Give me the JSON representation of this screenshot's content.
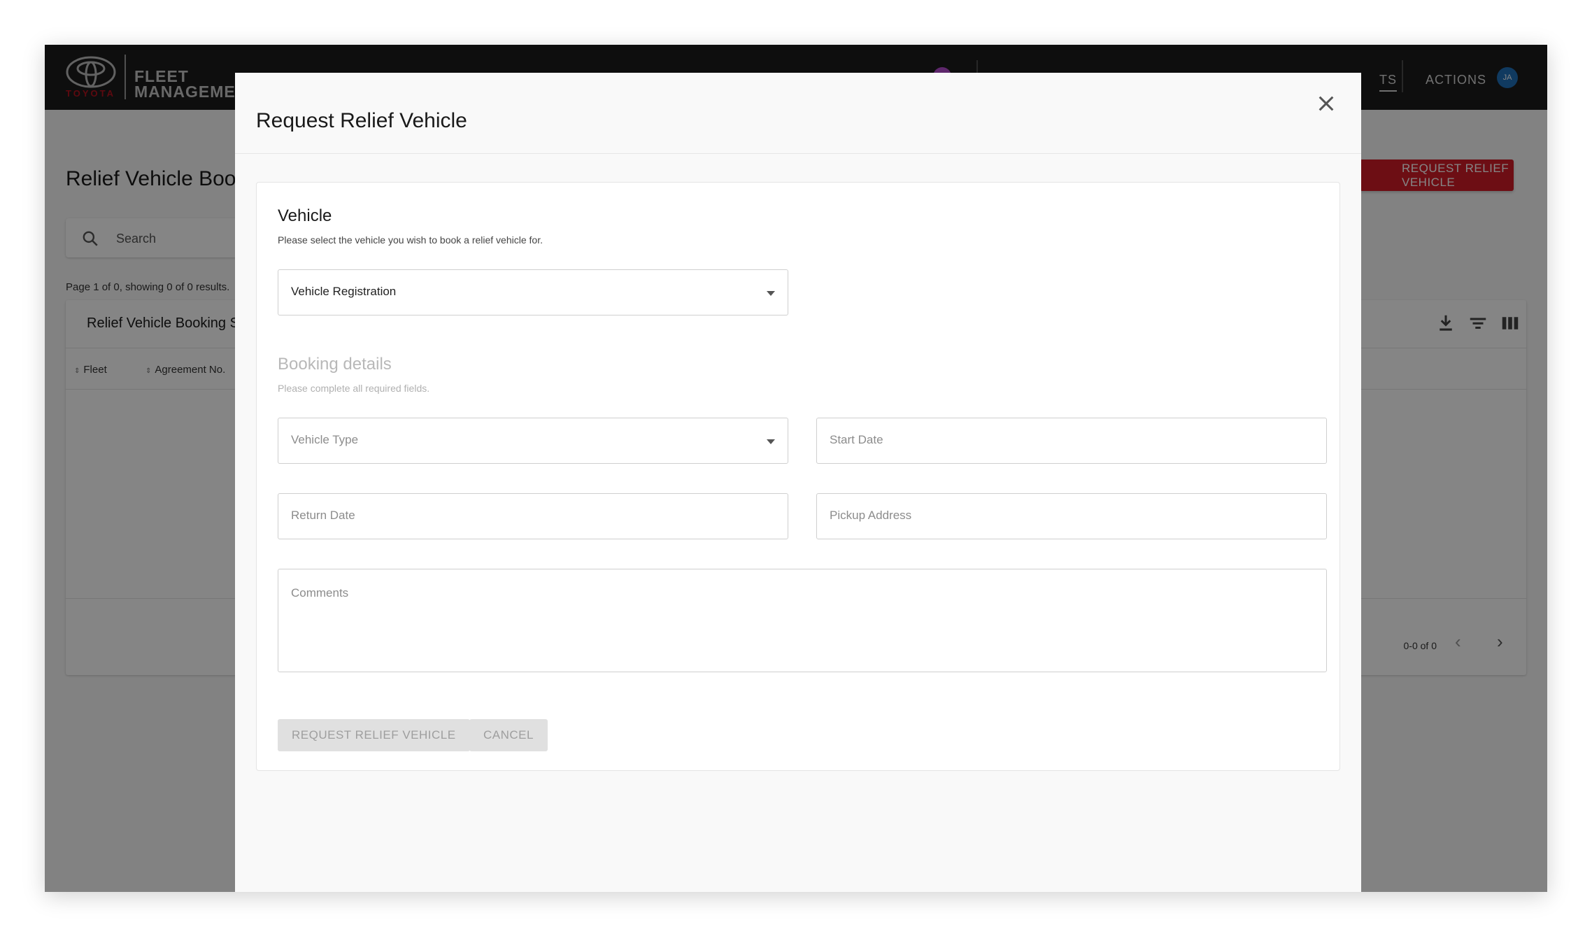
{
  "appbar": {
    "brand": "TOYOTA",
    "product_line1": "FLEET",
    "product_line2": "MANAGEMENT",
    "nav_partial": "TS",
    "actions": "ACTIONS",
    "avatar_initials": "JA",
    "accent_color": "#d21c28"
  },
  "page": {
    "title": "Relief Vehicle Bookings",
    "request_button": "REQUEST RELIEF VEHICLE",
    "search_placeholder": "Search",
    "page_info": "Page 1 of 0, showing 0 of 0 results.",
    "table_title": "Relief Vehicle Booking Summary",
    "columns": [
      "Fleet",
      "Agreement No."
    ],
    "pagination_range": "0-0 of 0"
  },
  "modal": {
    "title": "Request Relief Vehicle",
    "vehicle_section": {
      "title": "Vehicle",
      "subtitle": "Please select the vehicle you wish to book a relief vehicle for.",
      "registration_placeholder": "Vehicle Registration"
    },
    "booking_section": {
      "title": "Booking details",
      "subtitle": "Please complete all required fields.",
      "vehicle_type_placeholder": "Vehicle Type",
      "start_date_placeholder": "Start Date",
      "return_date_placeholder": "Return Date",
      "pickup_address_placeholder": "Pickup Address",
      "comments_placeholder": "Comments"
    },
    "submit_button": "REQUEST RELIEF VEHICLE",
    "cancel_button": "CANCEL"
  }
}
